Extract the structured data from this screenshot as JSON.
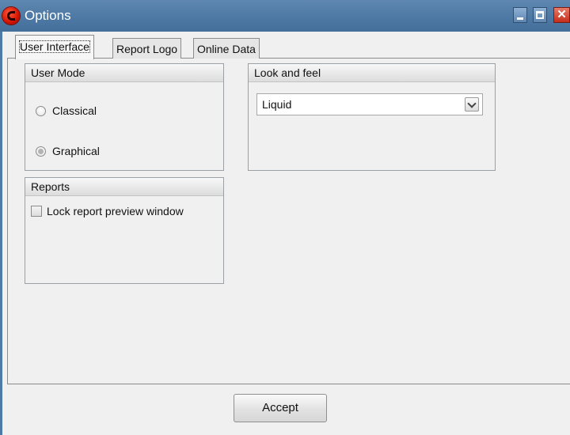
{
  "window": {
    "title": "Options",
    "icon": "app-logo-icon"
  },
  "tabs": [
    {
      "label": "User Interface",
      "active": true
    },
    {
      "label": "Report Logo",
      "active": false
    },
    {
      "label": "Online Data",
      "active": false
    }
  ],
  "user_mode": {
    "title": "User Mode",
    "options": [
      {
        "label": "Classical",
        "selected": false
      },
      {
        "label": "Graphical",
        "selected": true
      }
    ]
  },
  "look_and_feel": {
    "title": "Look and feel",
    "selected_value": "Liquid"
  },
  "reports": {
    "title": "Reports",
    "lock_preview_label": "Lock report preview window",
    "lock_preview_checked": false
  },
  "footer": {
    "accept_label": "Accept"
  },
  "colors": {
    "titlebar": "#4f7aa5",
    "close_button": "#c42e1a",
    "dialog_background": "#f0f0f0"
  }
}
